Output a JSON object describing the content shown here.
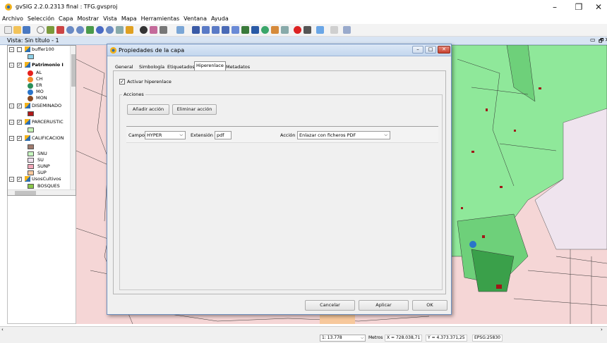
{
  "app": {
    "title": "gvSIG 2.2.0.2313 final : TFG.gvsproj"
  },
  "window_controls": {
    "minimize": "–",
    "maximize": "❐",
    "close": "✕"
  },
  "menubar": {
    "items": [
      "Archivo",
      "Selección",
      "Capa",
      "Mostrar",
      "Vista",
      "Mapa",
      "Herramientas",
      "Ventana",
      "Ayuda"
    ]
  },
  "view": {
    "title": "Vista: Sin título - 1",
    "controls": {
      "minimize": "▭",
      "maximize": "🗗",
      "close": "✕"
    }
  },
  "toc": {
    "layers": [
      {
        "name": "buffer100",
        "checked": false
      },
      {
        "name": "Patrimonio I",
        "checked": true,
        "legend": [
          {
            "label": "AL",
            "color": "#e6201c"
          },
          {
            "label": "CH",
            "color": "#f2892a"
          },
          {
            "label": "ER",
            "color": "#2a8f5a"
          },
          {
            "label": "MO",
            "color": "#2a74c9"
          },
          {
            "label": "MON",
            "color": "#8a4a22"
          }
        ]
      },
      {
        "name": "DISEMINADO",
        "checked": true,
        "legend_color": "#b01818"
      },
      {
        "name": "PARCERUSTIC",
        "checked": true,
        "legend_color": "#c6f2b4"
      },
      {
        "name": "CALIFICACION",
        "checked": true,
        "legend": [
          {
            "label": "",
            "color": "#a07b6e"
          },
          {
            "label": "SNU",
            "color": "#c7f6c0"
          },
          {
            "label": "SU",
            "color": "#f2e2f0"
          },
          {
            "label": "SUNP",
            "color": "#f2a6b8"
          },
          {
            "label": "SUP",
            "color": "#f7c89c"
          }
        ]
      },
      {
        "name": "UsosCultivos",
        "checked": true,
        "legend": [
          {
            "label": "BOSQUES",
            "color": "#8ac64a"
          }
        ]
      }
    ]
  },
  "dialog": {
    "title": "Propiedades de la capa",
    "tabs": [
      "General",
      "Simbología",
      "Etiquetados",
      "Hiperenlace",
      "Metadatos"
    ],
    "active_tab": "Hiperenlace",
    "activate_label": "Activar hiperenlace",
    "activate_checked": true,
    "actions_group": "Acciones",
    "add_action": "Añadir acción",
    "remove_action": "Eliminar acción",
    "field_label": "Campo",
    "field_value": "HYPER",
    "extension_label": "Extensión",
    "extension_value": "pdf",
    "action_label": "Acción",
    "action_value": "Enlazar con ficheros PDF",
    "cancel": "Cancelar",
    "apply": "Aplicar",
    "ok": "OK"
  },
  "status": {
    "scale": "1: 13.778",
    "units": "Metros",
    "x": "X = 728.038,71",
    "y": "Y = 4.373.371,25",
    "epsg": "EPSG:25830"
  }
}
